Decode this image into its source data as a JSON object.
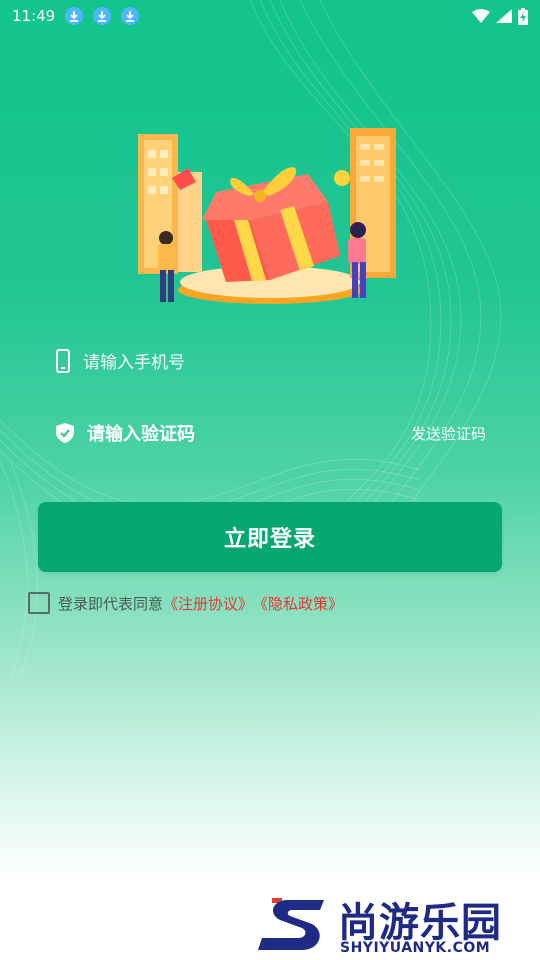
{
  "status_bar": {
    "time": "11:49",
    "notifications": [
      "download-icon",
      "download-icon",
      "download-icon"
    ],
    "right_icons": [
      "wifi-icon",
      "signal-icon",
      "battery-charging-icon"
    ]
  },
  "hero": {
    "illustration": "gift-box-with-buildings-and-people"
  },
  "form": {
    "phone_placeholder": "请输入手机号",
    "code_placeholder": "请输入验证码",
    "send_code_label": "发送验证码"
  },
  "login_button": {
    "label": "立即登录"
  },
  "agreement": {
    "prefix": "登录即代表同意",
    "terms_link": "《注册协议》",
    "privacy_link": "《隐私政策》",
    "checked": false
  },
  "watermark": {
    "title": "尚游乐园",
    "url": "SHYIYUANYK.COM"
  },
  "colors": {
    "primary": "#06a771",
    "background_top": "#12c48b",
    "link": "#e53935",
    "watermark": "#1f2a86"
  }
}
